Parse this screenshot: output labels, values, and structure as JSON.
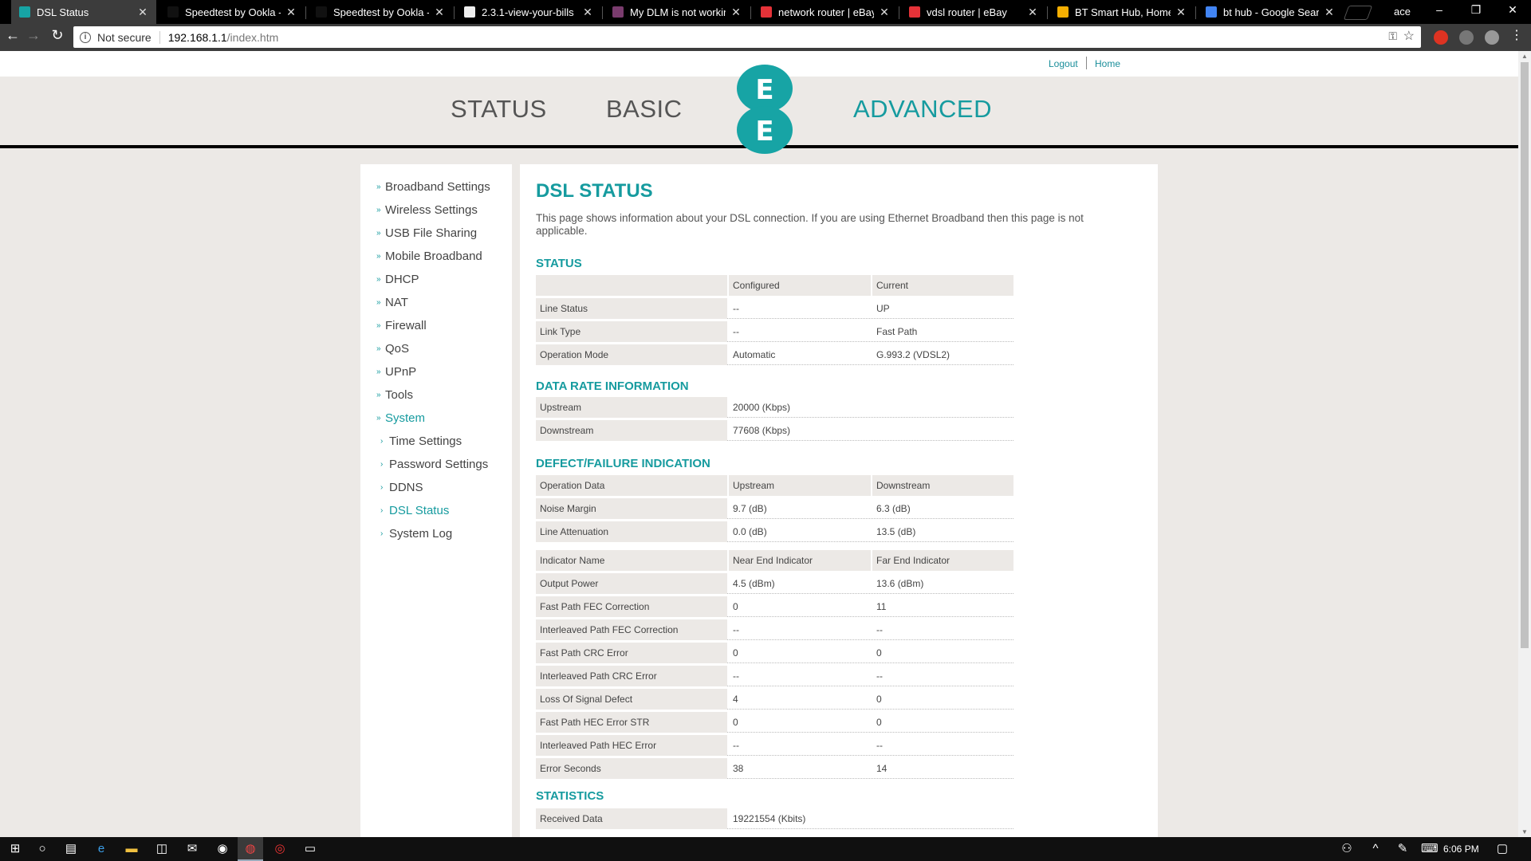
{
  "browser": {
    "tabs": [
      {
        "title": "DSL Status",
        "fav": "#17a4a5",
        "active": true
      },
      {
        "title": "Speedtest by Ookla - Th",
        "fav": "#111"
      },
      {
        "title": "Speedtest by Ookla - Th",
        "fav": "#111"
      },
      {
        "title": "2.3.1-view-your-bills",
        "fav": "#eee"
      },
      {
        "title": "My DLM is not working",
        "fav": "#7a3c6e"
      },
      {
        "title": "network router | eBay",
        "fav": "#e53238"
      },
      {
        "title": "vdsl router | eBay",
        "fav": "#e53238"
      },
      {
        "title": "BT Smart Hub, Home H",
        "fav": "#f5af02"
      },
      {
        "title": "bt hub - Google Search",
        "fav": "#4285f4"
      }
    ],
    "profile": "ace",
    "url_insecure_label": "Not secure",
    "url_host": "192.168.1.1",
    "url_path": "/index.htm"
  },
  "router": {
    "top_links": {
      "logout": "Logout",
      "home": "Home"
    },
    "nav": {
      "status": "STATUS",
      "basic": "BASIC",
      "advanced": "ADVANCED"
    },
    "logo_letter": "E",
    "sidebar": [
      {
        "label": "Broadband Settings",
        "sub": false
      },
      {
        "label": "Wireless Settings",
        "sub": false
      },
      {
        "label": "USB File Sharing",
        "sub": false
      },
      {
        "label": "Mobile Broadband",
        "sub": false
      },
      {
        "label": "DHCP",
        "sub": false
      },
      {
        "label": "NAT",
        "sub": false
      },
      {
        "label": "Firewall",
        "sub": false
      },
      {
        "label": "QoS",
        "sub": false
      },
      {
        "label": "UPnP",
        "sub": false
      },
      {
        "label": "Tools",
        "sub": false
      },
      {
        "label": "System",
        "sub": false,
        "open": true
      },
      {
        "label": "Time Settings",
        "sub": true
      },
      {
        "label": "Password Settings",
        "sub": true
      },
      {
        "label": "DDNS",
        "sub": true
      },
      {
        "label": "DSL Status",
        "sub": true,
        "current": true
      },
      {
        "label": "System Log",
        "sub": true
      }
    ],
    "title": "DSL STATUS",
    "description": "This page shows information about your DSL connection. If you are using Ethernet Broadband then this page is not applicable.",
    "sections": {
      "status": "STATUS",
      "data_rate": "DATA RATE INFORMATION",
      "defect": "DEFECT/FAILURE INDICATION",
      "statistics": "STATISTICS"
    },
    "status_table": {
      "header": [
        "",
        "Configured",
        "Current"
      ],
      "rows": [
        [
          "Line Status",
          "--",
          "UP"
        ],
        [
          "Link Type",
          "--",
          "Fast Path"
        ],
        [
          "Operation Mode",
          "Automatic",
          "G.993.2 (VDSL2)"
        ]
      ]
    },
    "data_rate_table": {
      "rows": [
        [
          "Upstream",
          "20000 (Kbps)"
        ],
        [
          "Downstream",
          "77608 (Kbps)"
        ]
      ]
    },
    "defect_table": {
      "header": [
        "Operation Data",
        "Upstream",
        "Downstream"
      ],
      "rows": [
        [
          "Noise Margin",
          "9.7 (dB)",
          "6.3 (dB)"
        ],
        [
          "Line Attenuation",
          "0.0 (dB)",
          "13.5 (dB)"
        ]
      ]
    },
    "indicator_table": {
      "header": [
        "Indicator Name",
        "Near End Indicator",
        "Far End Indicator"
      ],
      "rows": [
        [
          "Output Power",
          "4.5 (dBm)",
          "13.6 (dBm)"
        ],
        [
          "Fast Path FEC Correction",
          "0",
          "11"
        ],
        [
          "Interleaved Path FEC Correction",
          "--",
          "--"
        ],
        [
          "Fast Path CRC Error",
          "0",
          "0"
        ],
        [
          "Interleaved Path CRC Error",
          "--",
          "--"
        ],
        [
          "Loss Of Signal Defect",
          "4",
          "0"
        ],
        [
          "Fast Path HEC Error STR",
          "0",
          "0"
        ],
        [
          "Interleaved Path HEC Error",
          "--",
          "--"
        ],
        [
          "Error Seconds",
          "38",
          "14"
        ]
      ]
    },
    "statistics_table": {
      "rows": [
        [
          "Received Data",
          "19221554 (Kbits)"
        ]
      ]
    }
  },
  "taskbar": {
    "clock": "6:06 PM"
  }
}
